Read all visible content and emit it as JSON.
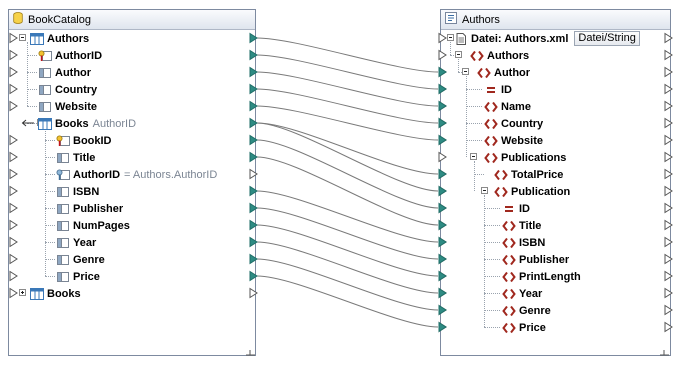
{
  "left_component": {
    "title": "BookCatalog",
    "rows": [
      {
        "label": "Authors",
        "annotation": ""
      },
      {
        "label": "AuthorID",
        "annotation": ""
      },
      {
        "label": "Author",
        "annotation": ""
      },
      {
        "label": "Country",
        "annotation": ""
      },
      {
        "label": "Website",
        "annotation": ""
      },
      {
        "label": "Books",
        "annotation": "AuthorID"
      },
      {
        "label": "BookID",
        "annotation": ""
      },
      {
        "label": "Title",
        "annotation": ""
      },
      {
        "label": "AuthorID",
        "annotation": "= Authors.AuthorID"
      },
      {
        "label": "ISBN",
        "annotation": ""
      },
      {
        "label": "Publisher",
        "annotation": ""
      },
      {
        "label": "NumPages",
        "annotation": ""
      },
      {
        "label": "Year",
        "annotation": ""
      },
      {
        "label": "Genre",
        "annotation": ""
      },
      {
        "label": "Price",
        "annotation": ""
      },
      {
        "label": "Books",
        "annotation": ""
      }
    ]
  },
  "right_component": {
    "title": "Authors",
    "file_label": "Datei: Authors.xml",
    "file_button": "Datei/String",
    "rows": [
      {
        "label": "Authors"
      },
      {
        "label": "Author"
      },
      {
        "label": "ID"
      },
      {
        "label": "Name"
      },
      {
        "label": "Country"
      },
      {
        "label": "Website"
      },
      {
        "label": "Publications"
      },
      {
        "label": "TotalPrice"
      },
      {
        "label": "Publication"
      },
      {
        "label": "ID"
      },
      {
        "label": "Title"
      },
      {
        "label": "ISBN"
      },
      {
        "label": "Publisher"
      },
      {
        "label": "PrintLength"
      },
      {
        "label": "Year"
      },
      {
        "label": "Genre"
      },
      {
        "label": "Price"
      }
    ]
  },
  "colors": {
    "connector": "#2e8b83",
    "connection_line": "#7a7a7a",
    "xml_element_icon": "#a0281e",
    "table_icon": "#3a78b8"
  },
  "icons": {
    "left_title": "database-icon",
    "right_title": "xml-schema-icon"
  }
}
